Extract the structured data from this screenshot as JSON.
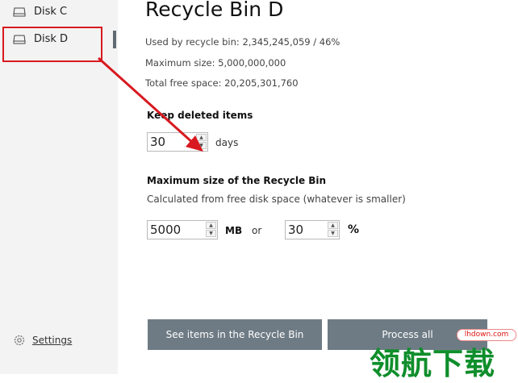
{
  "sidebar": {
    "items": [
      {
        "label": "Disk C",
        "icon": "drive-icon"
      },
      {
        "label": "Disk D",
        "icon": "drive-icon",
        "selected": true
      }
    ],
    "settings_label": "Settings"
  },
  "main": {
    "title": "Recycle Bin D",
    "used_by_recycle_bin": "Used by recycle bin: 2,345,245,059 / 46%",
    "maximum_size": "Maximum size: 5,000,000,000",
    "total_free_space": "Total free space: 20,205,301,760",
    "keep_deleted": {
      "title": "Keep deleted items",
      "days_value": "30",
      "unit": "days"
    },
    "max_size": {
      "title": "Maximum size of the Recycle Bin",
      "subtitle": "Calculated from free disk space (whatever is smaller)",
      "mb_value": "5000",
      "mb_unit": "MB",
      "or": "or",
      "pct_value": "30",
      "pct_unit": "%"
    }
  },
  "buttons": {
    "see_items": "See items in the Recycle Bin",
    "process_all": "Process all"
  },
  "watermark": {
    "site": "lhdown.com",
    "cn_text": "领航下载"
  },
  "colors": {
    "sidebar_bg": "#f3f3f3",
    "button_bg": "#6e7b84",
    "annotation_red": "#d8191f",
    "watermark_green": "#0f8e2b"
  }
}
